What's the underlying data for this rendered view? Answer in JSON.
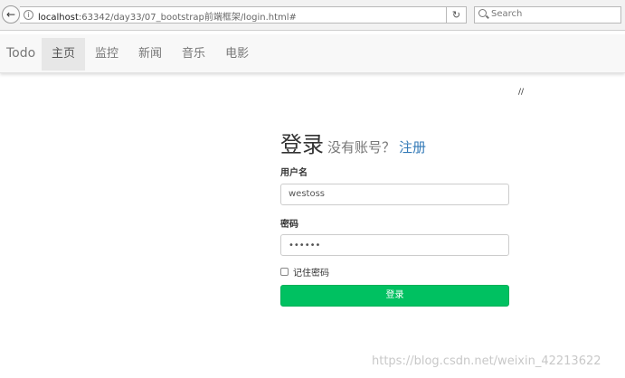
{
  "browser": {
    "url_host": "localhost",
    "url_path": ":63342/day33/07_bootstrap前端框架/login.html#",
    "search_placeholder": "Search",
    "back_icon": "back-arrow-icon",
    "reload_icon": "reload-icon"
  },
  "navbar": {
    "brand": "Todo",
    "items": [
      {
        "label": "主页",
        "active": true
      },
      {
        "label": "监控",
        "active": false
      },
      {
        "label": "新闻",
        "active": false
      },
      {
        "label": "音乐",
        "active": false
      },
      {
        "label": "电影",
        "active": false
      }
    ]
  },
  "page": {
    "slash_mark": "//"
  },
  "login": {
    "title": "登录",
    "subtitle": "没有账号？",
    "register_link": "注册",
    "username_label": "用户名",
    "username_value": "westoss",
    "password_label": "密码",
    "password_value": "••••••",
    "remember_label": "记住密码",
    "remember_checked": false,
    "submit_label": "登录"
  },
  "colors": {
    "submit_button": "#00c161",
    "link": "#337ab7",
    "navbar_bg": "#f8f8f8"
  },
  "watermark": "https://blog.csdn.net/weixin_42213622"
}
